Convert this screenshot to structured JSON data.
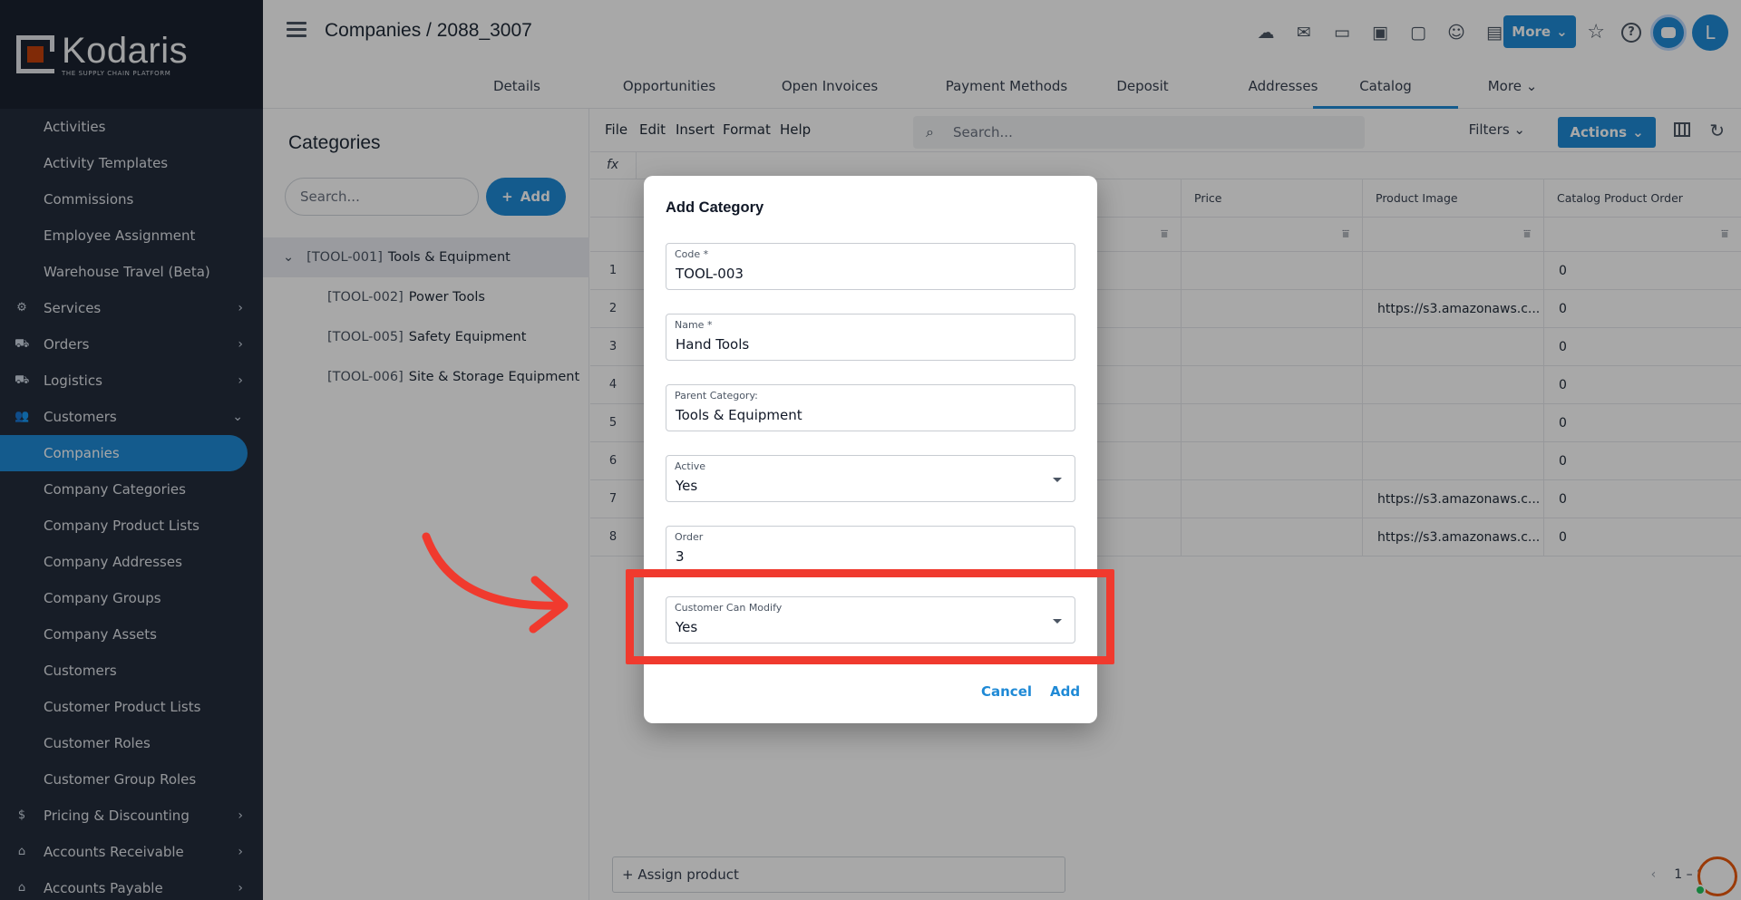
{
  "app": {
    "logo_name": "Kodaris",
    "logo_tagline": "THE SUPPLY CHAIN PLATFORM"
  },
  "sidebar": {
    "items": [
      {
        "label": "Activities",
        "kind": "sub"
      },
      {
        "label": "Activity Templates",
        "kind": "sub"
      },
      {
        "label": "Commissions",
        "kind": "sub"
      },
      {
        "label": "Employee Assignment",
        "kind": "sub"
      },
      {
        "label": "Warehouse Travel (Beta)",
        "kind": "sub"
      },
      {
        "label": "Services",
        "kind": "group",
        "icon": "services-icon",
        "chevron": "right"
      },
      {
        "label": "Orders",
        "kind": "group",
        "icon": "truck-icon",
        "chevron": "right"
      },
      {
        "label": "Logistics",
        "kind": "group",
        "icon": "logistics-icon",
        "chevron": "right"
      },
      {
        "label": "Customers",
        "kind": "group",
        "icon": "people-icon",
        "chevron": "down"
      },
      {
        "label": "Companies",
        "kind": "sub",
        "active": true
      },
      {
        "label": "Company Categories",
        "kind": "sub"
      },
      {
        "label": "Company Product Lists",
        "kind": "sub"
      },
      {
        "label": "Company Addresses",
        "kind": "sub"
      },
      {
        "label": "Company Groups",
        "kind": "sub"
      },
      {
        "label": "Company Assets",
        "kind": "sub"
      },
      {
        "label": "Customers",
        "kind": "sub"
      },
      {
        "label": "Customer Product Lists",
        "kind": "sub"
      },
      {
        "label": "Customer Roles",
        "kind": "sub"
      },
      {
        "label": "Customer Group Roles",
        "kind": "sub"
      },
      {
        "label": "Pricing & Discounting",
        "kind": "group",
        "icon": "dollar-icon",
        "chevron": "right"
      },
      {
        "label": "Accounts Receivable",
        "kind": "group",
        "icon": "bank-icon",
        "chevron": "right"
      },
      {
        "label": "Accounts Payable",
        "kind": "group",
        "icon": "bank-icon",
        "chevron": "right"
      }
    ]
  },
  "header": {
    "breadcrumb": "Companies / 2088_3007",
    "more_label": "More",
    "avatar_letter": "L",
    "icons": [
      "cloud-upload-icon",
      "mail-icon",
      "card-check-icon",
      "gift-icon",
      "monitor-plus-icon",
      "person-add-icon",
      "file-plus-icon",
      "paperclip-icon"
    ]
  },
  "tabs": [
    {
      "label": "Details"
    },
    {
      "label": "Opportunities"
    },
    {
      "label": "Open Invoices"
    },
    {
      "label": "Payment Methods"
    },
    {
      "label": "Deposit"
    },
    {
      "label": "Addresses"
    },
    {
      "label": "Catalog",
      "active": true
    },
    {
      "label": "More"
    }
  ],
  "categories": {
    "title": "Categories",
    "search_placeholder": "Search...",
    "add_label": "Add",
    "tree": [
      {
        "code": "[TOOL-001]",
        "name": "Tools & Equipment",
        "level": 0,
        "expanded": true,
        "selected": true
      },
      {
        "code": "[TOOL-002]",
        "name": "Power Tools",
        "level": 1
      },
      {
        "code": "[TOOL-005]",
        "name": "Safety Equipment",
        "level": 1
      },
      {
        "code": "[TOOL-006]",
        "name": "Site & Storage Equipment",
        "level": 1
      }
    ]
  },
  "grid": {
    "menu": [
      "File",
      "Edit",
      "Insert",
      "Format",
      "Help"
    ],
    "search_placeholder": "Search...",
    "filters_label": "Filters",
    "actions_label": "Actions",
    "fx_label": "fx",
    "columns": [
      "Price",
      "Product Image",
      "Catalog Product Order"
    ],
    "rows": [
      {
        "n": "1",
        "price": "",
        "image": "",
        "order": "0"
      },
      {
        "n": "2",
        "price": "",
        "image": "https://s3.amazonaws.c...",
        "order": "0"
      },
      {
        "n": "3",
        "price": "",
        "image": "",
        "order": "0"
      },
      {
        "n": "4",
        "price": "",
        "image": "",
        "order": "0"
      },
      {
        "n": "5",
        "price": "",
        "image": "",
        "order": "0"
      },
      {
        "n": "6",
        "price": "",
        "image": "",
        "order": "0"
      },
      {
        "n": "7",
        "price": "",
        "image": "https://s3.amazonaws.c...",
        "order": "0"
      },
      {
        "n": "8",
        "price": "",
        "image": "https://s3.amazonaws.c...",
        "order": "0"
      }
    ],
    "assign_label": "+ Assign product",
    "pager_text": "1 – 8"
  },
  "modal": {
    "title": "Add Category",
    "fields": [
      {
        "label": "Code *",
        "value": "TOOL-003",
        "type": "text"
      },
      {
        "label": "Name *",
        "value": "Hand Tools",
        "type": "text"
      },
      {
        "label": "Parent Category:",
        "value": "Tools & Equipment",
        "type": "text"
      },
      {
        "label": "Active",
        "value": "Yes",
        "type": "select"
      },
      {
        "label": "Order",
        "value": "3",
        "type": "text"
      },
      {
        "label": "Customer Can Modify",
        "value": "Yes",
        "type": "select"
      }
    ],
    "cancel_label": "Cancel",
    "add_label": "Add"
  },
  "colors": {
    "accent": "#1f8ad6",
    "sidebar_bg": "#242d3c",
    "highlight": "#f03a2e"
  }
}
